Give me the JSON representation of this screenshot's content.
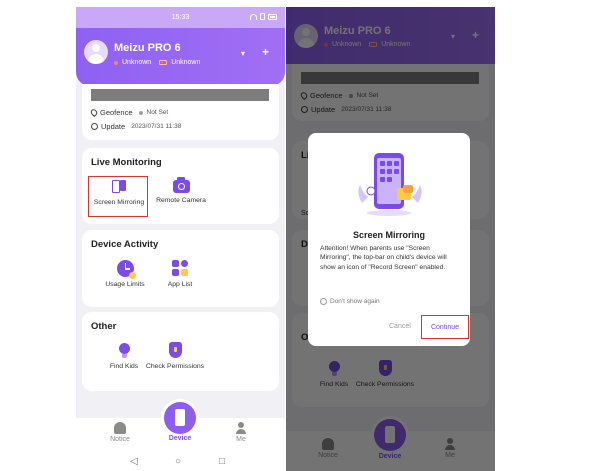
{
  "status": {
    "time": "15:33"
  },
  "device": {
    "name": "Meizu PRO 6",
    "status1": "Unknown",
    "status2": "Unknown"
  },
  "header": {
    "dropdown_glyph": "▾",
    "add_glyph": "+"
  },
  "info": {
    "geofence_label": "Geofence",
    "geofence_value": "Not Set",
    "update_label": "Update",
    "update_value": "2023/07/31 11:38"
  },
  "sections": {
    "live": {
      "title": "Live Monitoring",
      "items": [
        "Screen Mirroring",
        "Remote Camera"
      ]
    },
    "activity": {
      "title": "Device Activity",
      "items": [
        "Usage Limits",
        "App List"
      ]
    },
    "other": {
      "title": "Other",
      "items": [
        "Find Kids",
        "Check Permissions"
      ]
    }
  },
  "nav": {
    "notice": "Notice",
    "device": "Device",
    "me": "Me"
  },
  "sysnav": {
    "back": "◁",
    "home": "○",
    "recent": "□"
  },
  "dialog": {
    "title": "Screen Mirroring",
    "body": "Attention! When parents use \"Screen Mirroring\", the top-bar on child's device will show an icon of \"Record Screen\" enabled.",
    "checkbox": "Don't show again",
    "cancel": "Cancel",
    "continue": "Continue"
  },
  "partial": {
    "live": "Li",
    "activity": "De",
    "other": "O",
    "screen": "Sc"
  },
  "colors": {
    "primary": "#8f61f1",
    "highlight": "#e0332b",
    "accent_yellow": "#ffc940"
  }
}
